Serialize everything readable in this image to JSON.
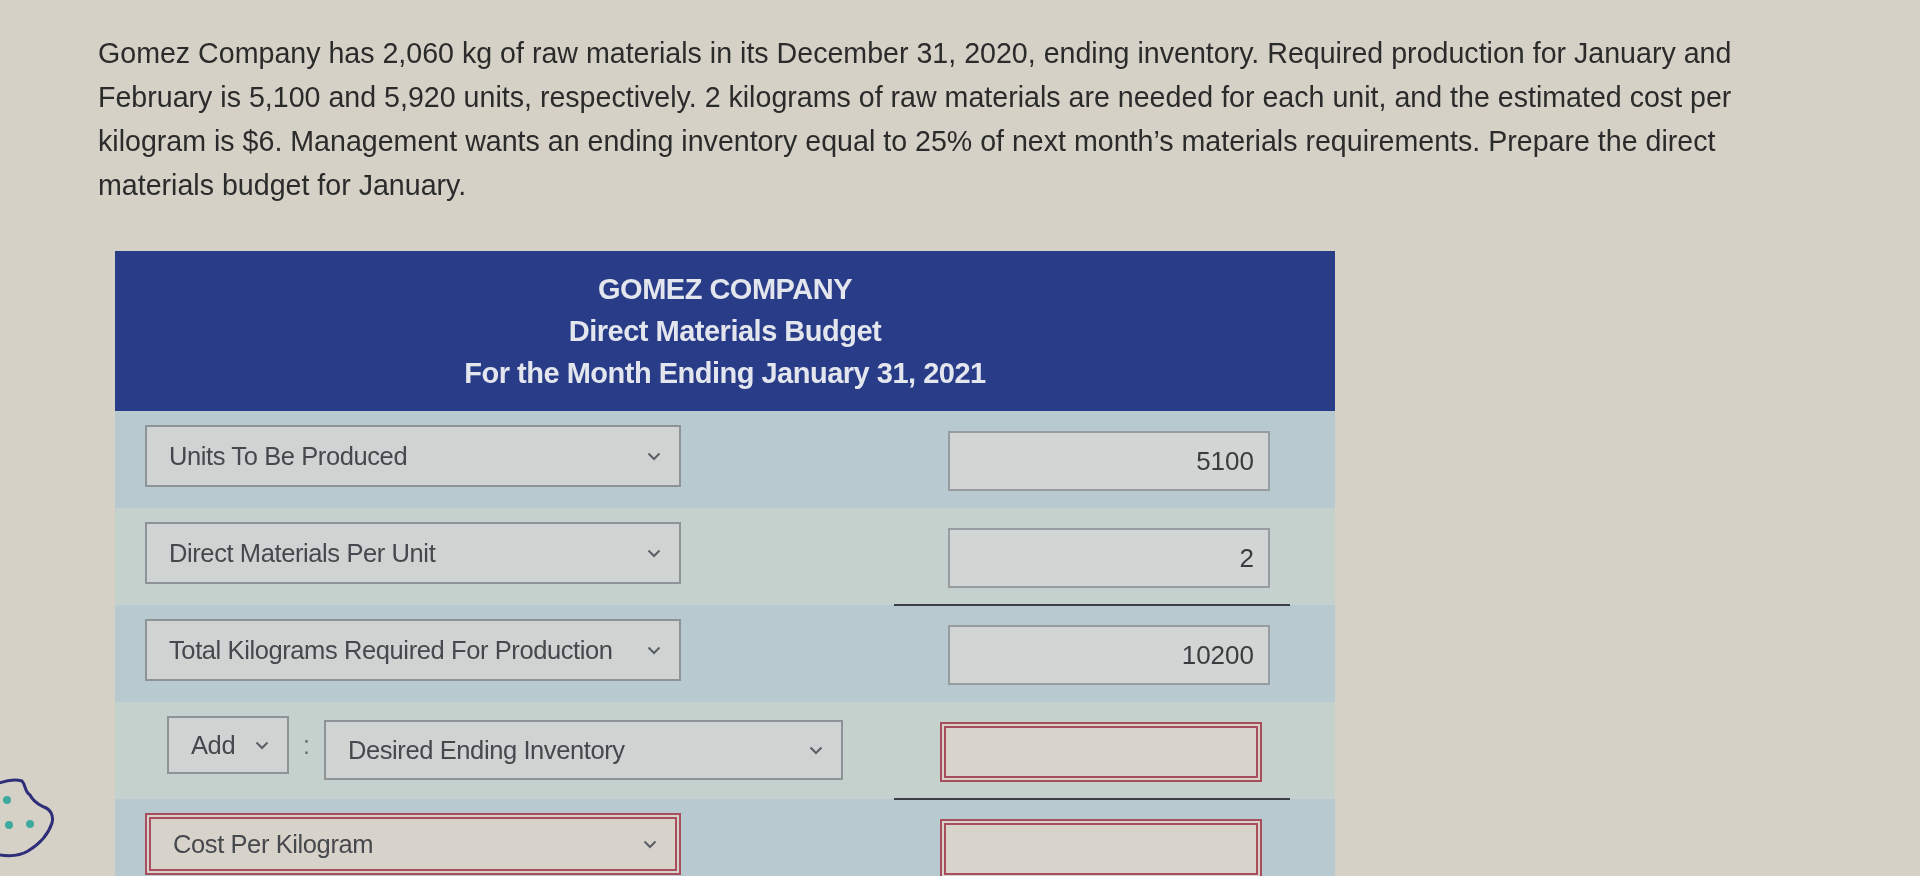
{
  "problem": {
    "text": "Gomez Company has 2,060 kg of raw materials in its December 31, 2020, ending inventory. Required production for January and February is 5,100 and 5,920 units, respectively. 2 kilograms of raw materials are needed for each unit, and the estimated cost per kilogram is $6. Management wants an ending inventory equal to 25% of next month’s materials requirements. Prepare the direct materials budget for January."
  },
  "budget": {
    "title_lines": [
      "GOMEZ COMPANY",
      "Direct Materials Budget",
      "For the Month Ending January 31, 2021"
    ],
    "rows": [
      {
        "kind": "line",
        "label": {
          "text": "Units To Be Produced",
          "error": false
        },
        "amount": {
          "value": "5100",
          "error": false
        },
        "underlined": false
      },
      {
        "kind": "line",
        "label": {
          "text": "Direct Materials Per Unit",
          "error": false
        },
        "amount": {
          "value": "2",
          "error": false
        },
        "underlined": true
      },
      {
        "kind": "line",
        "label": {
          "text": "Total Kilograms Required For Production",
          "error": false
        },
        "amount": {
          "value": "10200",
          "error": false
        },
        "underlined": false
      },
      {
        "kind": "prefixed",
        "prefix": "Add",
        "separator": ":",
        "label": {
          "text": "Desired Ending Inventory",
          "error": false
        },
        "amount": {
          "error": true
        },
        "underlined": true
      },
      {
        "kind": "line",
        "label": {
          "text": "Cost Per Kilogram",
          "error": true
        },
        "amount": {
          "error": true
        },
        "underlined": false
      }
    ]
  }
}
